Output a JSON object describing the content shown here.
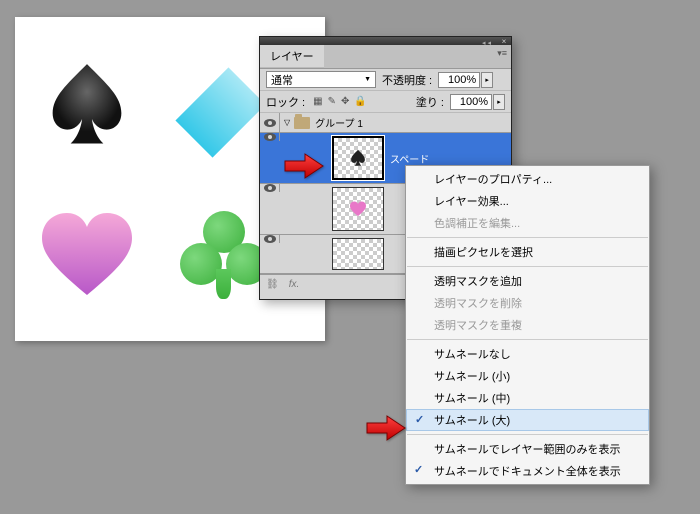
{
  "panel": {
    "tab": "レイヤー",
    "blend_mode": "通常",
    "opacity_label": "不透明度 :",
    "opacity_value": "100%",
    "lock_label": "ロック :",
    "fill_label": "塗り :",
    "fill_value": "100%",
    "group_name": "グループ 1",
    "layers": [
      {
        "name": "スペード"
      },
      {
        "name": ""
      },
      {
        "name": ""
      }
    ]
  },
  "context_menu": {
    "items": [
      {
        "label": "レイヤーのプロパティ..."
      },
      {
        "label": "レイヤー効果..."
      },
      {
        "label": "色調補正を編集...",
        "disabled": true
      }
    ],
    "group2": [
      {
        "label": "描画ピクセルを選択"
      }
    ],
    "group3": [
      {
        "label": "透明マスクを追加"
      },
      {
        "label": "透明マスクを削除",
        "disabled": true
      },
      {
        "label": "透明マスクを重複",
        "disabled": true
      }
    ],
    "group4": [
      {
        "label": "サムネールなし"
      },
      {
        "label": "サムネール (小)"
      },
      {
        "label": "サムネール (中)"
      },
      {
        "label": "サムネール (大)",
        "checked": true,
        "highlighted": true
      }
    ],
    "group5": [
      {
        "label": "サムネールでレイヤー範囲のみを表示"
      },
      {
        "label": "サムネールでドキュメント全体を表示",
        "checked": true
      }
    ]
  }
}
